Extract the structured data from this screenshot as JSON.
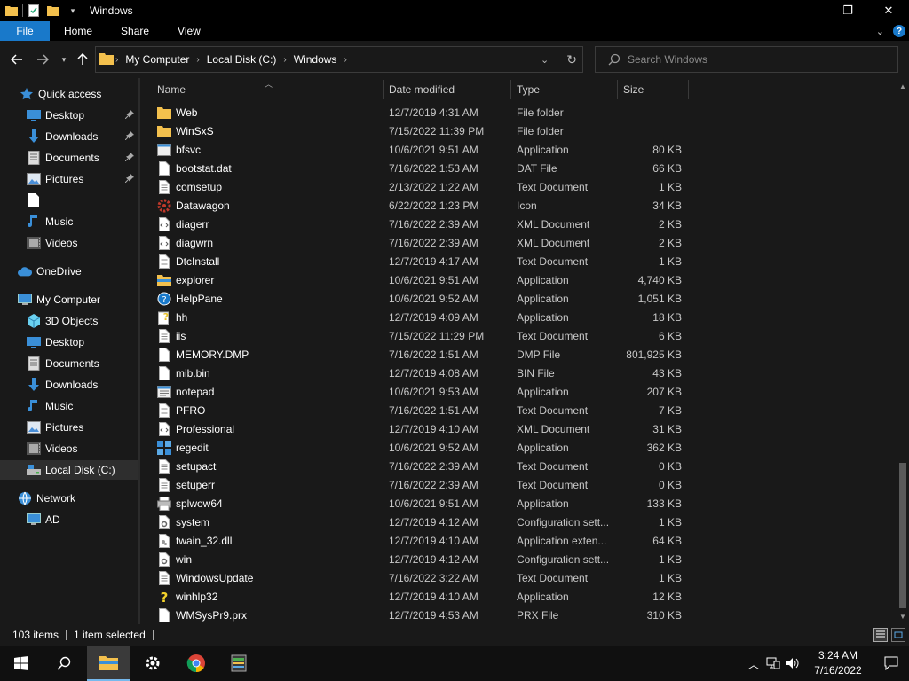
{
  "window": {
    "title": "Windows"
  },
  "window_controls": {
    "minimize": "—",
    "maximize": "❐",
    "close": "✕"
  },
  "ribbon": {
    "tabs": [
      "File",
      "Home",
      "Share",
      "View"
    ]
  },
  "address": {
    "crumbs": [
      "My Computer",
      "Local Disk (C:)",
      "Windows"
    ]
  },
  "search": {
    "placeholder": "Search Windows"
  },
  "columns": {
    "name": "Name",
    "date": "Date modified",
    "type": "Type",
    "size": "Size"
  },
  "nav": [
    {
      "label": "Quick access",
      "icon": "star-icon",
      "pin": false
    },
    {
      "label": "Desktop",
      "icon": "desktop-icon",
      "pin": true
    },
    {
      "label": "Downloads",
      "icon": "download-icon",
      "pin": true
    },
    {
      "label": "Documents",
      "icon": "documents-icon",
      "pin": true
    },
    {
      "label": "Pictures",
      "icon": "pictures-icon",
      "pin": true
    },
    {
      "label": "",
      "icon": "blank-file-icon",
      "pin": false
    },
    {
      "label": "Music",
      "icon": "music-icon",
      "pin": false
    },
    {
      "label": "Videos",
      "icon": "videos-icon",
      "pin": false
    },
    {
      "label": "OneDrive",
      "icon": "cloud-icon",
      "pin": false
    },
    {
      "label": "My Computer",
      "icon": "computer-icon",
      "pin": false
    },
    {
      "label": "3D Objects",
      "icon": "cube-icon",
      "pin": false
    },
    {
      "label": "Desktop",
      "icon": "desktop-icon",
      "pin": false
    },
    {
      "label": "Documents",
      "icon": "documents-icon",
      "pin": false
    },
    {
      "label": "Downloads",
      "icon": "download-icon",
      "pin": false
    },
    {
      "label": "Music",
      "icon": "music-icon",
      "pin": false
    },
    {
      "label": "Pictures",
      "icon": "pictures-icon",
      "pin": false
    },
    {
      "label": "Videos",
      "icon": "videos-icon",
      "pin": false
    },
    {
      "label": "Local Disk (C:)",
      "icon": "drive-icon",
      "pin": false,
      "selected": true
    },
    {
      "label": "Network",
      "icon": "network-icon",
      "pin": false
    },
    {
      "label": "AD",
      "icon": "computer-icon",
      "pin": false
    }
  ],
  "files": [
    {
      "name": "Web",
      "date": "12/7/2019 4:31 AM",
      "type": "File folder",
      "size": "",
      "icon": "folder-icon"
    },
    {
      "name": "WinSxS",
      "date": "7/15/2022 11:39 PM",
      "type": "File folder",
      "size": "",
      "icon": "folder-icon"
    },
    {
      "name": "bfsvc",
      "date": "10/6/2021 9:51 AM",
      "type": "Application",
      "size": "80 KB",
      "icon": "app-icon"
    },
    {
      "name": "bootstat.dat",
      "date": "7/16/2022 1:53 AM",
      "type": "DAT File",
      "size": "66 KB",
      "icon": "file-icon"
    },
    {
      "name": "comsetup",
      "date": "2/13/2022 1:22 AM",
      "type": "Text Document",
      "size": "1 KB",
      "icon": "text-file-icon"
    },
    {
      "name": "Datawagon",
      "date": "6/22/2022 1:23 PM",
      "type": "Icon",
      "size": "34 KB",
      "icon": "gear-red-icon"
    },
    {
      "name": "diagerr",
      "date": "7/16/2022 2:39 AM",
      "type": "XML Document",
      "size": "2 KB",
      "icon": "xml-file-icon"
    },
    {
      "name": "diagwrn",
      "date": "7/16/2022 2:39 AM",
      "type": "XML Document",
      "size": "2 KB",
      "icon": "xml-file-icon"
    },
    {
      "name": "DtcInstall",
      "date": "12/7/2019 4:17 AM",
      "type": "Text Document",
      "size": "1 KB",
      "icon": "text-file-icon"
    },
    {
      "name": "explorer",
      "date": "10/6/2021 9:51 AM",
      "type": "Application",
      "size": "4,740 KB",
      "icon": "explorer-icon"
    },
    {
      "name": "HelpPane",
      "date": "10/6/2021 9:52 AM",
      "type": "Application",
      "size": "1,051 KB",
      "icon": "help-circle-icon"
    },
    {
      "name": "hh",
      "date": "12/7/2019 4:09 AM",
      "type": "Application",
      "size": "18 KB",
      "icon": "help-doc-icon"
    },
    {
      "name": "iis",
      "date": "7/15/2022 11:29 PM",
      "type": "Text Document",
      "size": "6 KB",
      "icon": "text-file-icon"
    },
    {
      "name": "MEMORY.DMP",
      "date": "7/16/2022 1:51 AM",
      "type": "DMP File",
      "size": "801,925 KB",
      "icon": "file-icon"
    },
    {
      "name": "mib.bin",
      "date": "12/7/2019 4:08 AM",
      "type": "BIN File",
      "size": "43 KB",
      "icon": "file-icon"
    },
    {
      "name": "notepad",
      "date": "10/6/2021 9:53 AM",
      "type": "Application",
      "size": "207 KB",
      "icon": "notepad-icon"
    },
    {
      "name": "PFRO",
      "date": "7/16/2022 1:51 AM",
      "type": "Text Document",
      "size": "7 KB",
      "icon": "text-file-icon"
    },
    {
      "name": "Professional",
      "date": "12/7/2019 4:10 AM",
      "type": "XML Document",
      "size": "31 KB",
      "icon": "xml-file-icon"
    },
    {
      "name": "regedit",
      "date": "10/6/2021 9:52 AM",
      "type": "Application",
      "size": "362 KB",
      "icon": "regedit-icon"
    },
    {
      "name": "setupact",
      "date": "7/16/2022 2:39 AM",
      "type": "Text Document",
      "size": "0 KB",
      "icon": "text-file-icon"
    },
    {
      "name": "setuperr",
      "date": "7/16/2022 2:39 AM",
      "type": "Text Document",
      "size": "0 KB",
      "icon": "text-file-icon"
    },
    {
      "name": "splwow64",
      "date": "10/6/2021 9:51 AM",
      "type": "Application",
      "size": "133 KB",
      "icon": "printer-icon"
    },
    {
      "name": "system",
      "date": "12/7/2019 4:12 AM",
      "type": "Configuration sett...",
      "size": "1 KB",
      "icon": "config-file-icon"
    },
    {
      "name": "twain_32.dll",
      "date": "12/7/2019 4:10 AM",
      "type": "Application exten...",
      "size": "64 KB",
      "icon": "dll-file-icon"
    },
    {
      "name": "win",
      "date": "12/7/2019 4:12 AM",
      "type": "Configuration sett...",
      "size": "1 KB",
      "icon": "config-file-icon"
    },
    {
      "name": "WindowsUpdate",
      "date": "7/16/2022 3:22 AM",
      "type": "Text Document",
      "size": "1 KB",
      "icon": "text-file-icon"
    },
    {
      "name": "winhlp32",
      "date": "12/7/2019 4:10 AM",
      "type": "Application",
      "size": "12 KB",
      "icon": "help-question-icon"
    },
    {
      "name": "WMSysPr9.prx",
      "date": "12/7/2019 4:53 AM",
      "type": "PRX File",
      "size": "310 KB",
      "icon": "file-icon"
    }
  ],
  "status": {
    "items": "103 items",
    "selected": "1 item selected"
  },
  "taskbar": {
    "apps": [
      "start-icon",
      "search-icon",
      "file-explorer-icon",
      "settings-icon",
      "chrome-icon",
      "app-icon"
    ],
    "time": "3:24 AM",
    "date": "7/16/2022"
  },
  "colors": {
    "accent": "#1979ca",
    "folder": "#f3c04d",
    "background": "#191919"
  }
}
